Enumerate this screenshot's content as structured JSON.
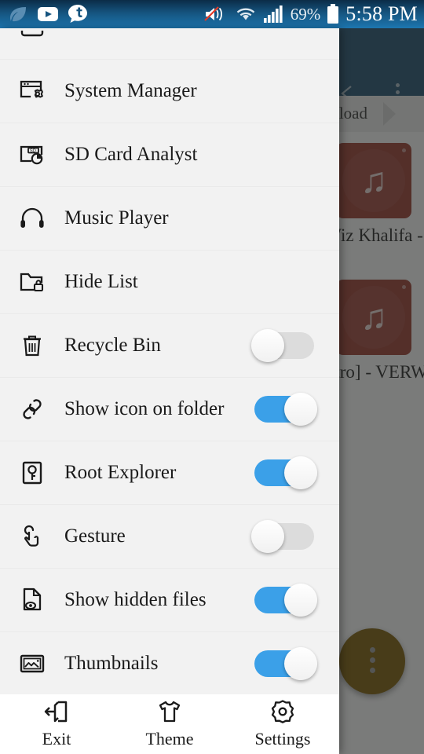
{
  "status_bar": {
    "left_icons": [
      "leaf-icon",
      "youtube-icon",
      "tumblr-chat-icon"
    ],
    "right_icons": [
      "volume-muted-icon",
      "wifi-icon",
      "cellular-signal-icon",
      "battery-icon"
    ],
    "battery_percent": "69%",
    "time": "5:58 PM"
  },
  "background_app": {
    "back_icon": "back-chevron-icon",
    "overflow_icon": "overflow-menu-icon",
    "breadcrumb": "wnload",
    "files": [
      {
        "name": "Wiz Khalifa -",
        "icon": "music-file-icon"
      },
      {
        "name": "[Electro] - VERWER",
        "icon": "music-file-icon"
      }
    ],
    "fab": "overflow-fab"
  },
  "drawer": {
    "items": [
      {
        "label": "",
        "icon": "partial-cut-item",
        "type": "nav",
        "partial": true
      },
      {
        "label": "System Manager",
        "icon": "system-manager-icon",
        "type": "nav"
      },
      {
        "label": "SD Card Analyst",
        "icon": "sd-card-analyst-icon",
        "type": "nav"
      },
      {
        "label": "Music Player",
        "icon": "headphones-icon",
        "type": "nav"
      },
      {
        "label": "Hide List",
        "icon": "folder-lock-icon",
        "type": "nav"
      },
      {
        "label": "Recycle Bin",
        "icon": "trash-icon",
        "type": "toggle",
        "value": "off"
      },
      {
        "label": "Show icon on folder",
        "icon": "link-chain-icon",
        "type": "toggle",
        "value": "on"
      },
      {
        "label": "Root Explorer",
        "icon": "root-key-icon",
        "type": "toggle",
        "value": "on"
      },
      {
        "label": "Gesture",
        "icon": "hand-tap-icon",
        "type": "toggle",
        "value": "off"
      },
      {
        "label": "Show hidden files",
        "icon": "file-eye-icon",
        "type": "toggle",
        "value": "on"
      },
      {
        "label": "Thumbnails",
        "icon": "image-thumbnail-icon",
        "type": "toggle",
        "value": "on"
      }
    ],
    "toolbar": [
      {
        "label": "Exit",
        "icon": "exit-icon"
      },
      {
        "label": "Theme",
        "icon": "tshirt-icon"
      },
      {
        "label": "Settings",
        "icon": "gear-icon"
      }
    ]
  },
  "colors": {
    "toggle_on": "#3ba0e8",
    "toggle_off": "#dcdcdc",
    "drawer_bg": "#f2f2f2",
    "appbar": "#1b4e70",
    "fab": "#7d5a00",
    "thumb": "#9c382c",
    "statusbar": "#15547f"
  }
}
